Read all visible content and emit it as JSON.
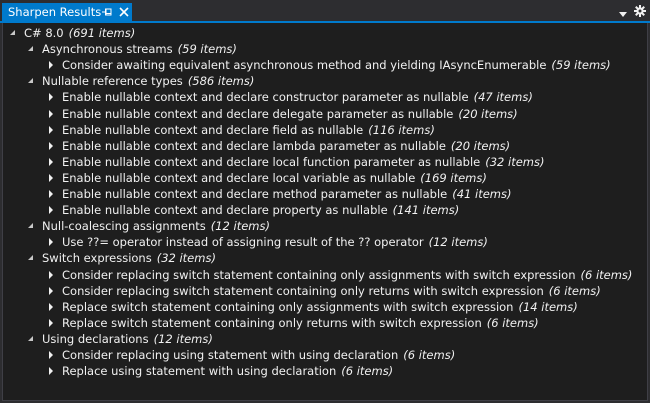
{
  "window": {
    "title": "Sharpen Results"
  },
  "tree": {
    "label": "C# 8.0",
    "count": "(691 items)",
    "groups": [
      {
        "label": "Asynchronous streams",
        "count": "(59 items)",
        "items": [
          {
            "label": "Consider awaiting equivalent asynchronous method and yielding IAsyncEnumerable",
            "count": "(59 items)"
          }
        ]
      },
      {
        "label": "Nullable reference types",
        "count": "(586 items)",
        "items": [
          {
            "label": "Enable nullable context and declare constructor parameter as nullable",
            "count": "(47 items)"
          },
          {
            "label": "Enable nullable context and declare delegate parameter as nullable",
            "count": "(20 items)"
          },
          {
            "label": "Enable nullable context and declare field as nullable",
            "count": "(116 items)"
          },
          {
            "label": "Enable nullable context and declare lambda parameter as nullable",
            "count": "(20 items)"
          },
          {
            "label": "Enable nullable context and declare local function parameter as nullable",
            "count": "(32 items)"
          },
          {
            "label": "Enable nullable context and declare local variable as nullable",
            "count": "(169 items)"
          },
          {
            "label": "Enable nullable context and declare method parameter as nullable",
            "count": "(41 items)"
          },
          {
            "label": "Enable nullable context and declare property as nullable",
            "count": "(141 items)"
          }
        ]
      },
      {
        "label": "Null-coalescing assignments",
        "count": "(12 items)",
        "items": [
          {
            "label": "Use ??= operator instead of assigning result of the ?? operator",
            "count": "(12 items)"
          }
        ]
      },
      {
        "label": "Switch expressions",
        "count": "(32 items)",
        "items": [
          {
            "label": "Consider replacing switch statement containing only assignments with switch expression",
            "count": "(6 items)"
          },
          {
            "label": "Consider replacing switch statement containing only returns with switch expression",
            "count": "(6 items)"
          },
          {
            "label": "Replace switch statement containing only assignments with switch expression",
            "count": "(14 items)"
          },
          {
            "label": "Replace switch statement containing only returns with switch expression",
            "count": "(6 items)"
          }
        ]
      },
      {
        "label": "Using declarations",
        "count": "(12 items)",
        "items": [
          {
            "label": "Consider replacing using statement with using declaration",
            "count": "(6 items)"
          },
          {
            "label": "Replace using statement with using declaration",
            "count": "(6 items)"
          }
        ]
      }
    ]
  }
}
